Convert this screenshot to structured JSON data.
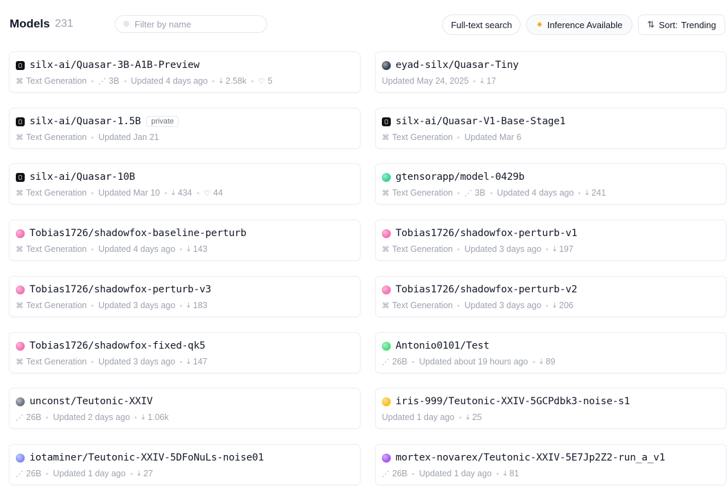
{
  "header": {
    "title": "Models",
    "count": "231",
    "filter_placeholder": "Filter by name",
    "full_text_search": "Full-text search",
    "inference_available": "Inference Available",
    "sort_label": "Sort:",
    "sort_value": "Trending"
  },
  "colors": {
    "accent": "#f59e0b",
    "border": "#e5e7eb",
    "muted_text": "#9ca3af"
  },
  "models": [
    {
      "name": "silx-ai/Quasar-3B-A1B-Preview",
      "avatar": "dark-square",
      "badge": "",
      "pipeline": "Text Generation",
      "params": "3B",
      "updated": "Updated 4 days ago",
      "downloads": "2.58k",
      "likes": "5"
    },
    {
      "name": "eyad-silx/Quasar-Tiny",
      "avatar": "#374151",
      "badge": "",
      "pipeline": "",
      "params": "",
      "updated": "Updated May 24, 2025",
      "downloads": "17",
      "likes": ""
    },
    {
      "name": "silx-ai/Quasar-1.5B",
      "avatar": "dark-square",
      "badge": "private",
      "pipeline": "Text Generation",
      "params": "",
      "updated": "Updated Jan 21",
      "downloads": "",
      "likes": ""
    },
    {
      "name": "silx-ai/Quasar-V1-Base-Stage1",
      "avatar": "dark-square",
      "badge": "",
      "pipeline": "Text Generation",
      "params": "",
      "updated": "Updated Mar 6",
      "downloads": "",
      "likes": ""
    },
    {
      "name": "silx-ai/Quasar-10B",
      "avatar": "dark-square",
      "badge": "",
      "pipeline": "Text Generation",
      "params": "",
      "updated": "Updated Mar 10",
      "downloads": "434",
      "likes": "44"
    },
    {
      "name": "gtensorapp/model-0429b",
      "avatar": "#34d399",
      "badge": "",
      "pipeline": "Text Generation",
      "params": "3B",
      "updated": "Updated 4 days ago",
      "downloads": "241",
      "likes": ""
    },
    {
      "name": "Tobias1726/shadowfox-baseline-perturb",
      "avatar": "#f472b6",
      "badge": "",
      "pipeline": "Text Generation",
      "params": "",
      "updated": "Updated 4 days ago",
      "downloads": "143",
      "likes": ""
    },
    {
      "name": "Tobias1726/shadowfox-perturb-v1",
      "avatar": "#f472b6",
      "badge": "",
      "pipeline": "Text Generation",
      "params": "",
      "updated": "Updated 3 days ago",
      "downloads": "197",
      "likes": ""
    },
    {
      "name": "Tobias1726/shadowfox-perturb-v3",
      "avatar": "#f472b6",
      "badge": "",
      "pipeline": "Text Generation",
      "params": "",
      "updated": "Updated 3 days ago",
      "downloads": "183",
      "likes": ""
    },
    {
      "name": "Tobias1726/shadowfox-perturb-v2",
      "avatar": "#f472b6",
      "badge": "",
      "pipeline": "Text Generation",
      "params": "",
      "updated": "Updated 3 days ago",
      "downloads": "206",
      "likes": ""
    },
    {
      "name": "Tobias1726/shadowfox-fixed-qk5",
      "avatar": "#f472b6",
      "badge": "",
      "pipeline": "Text Generation",
      "params": "",
      "updated": "Updated 3 days ago",
      "downloads": "147",
      "likes": ""
    },
    {
      "name": "Antonio0101/Test",
      "avatar": "#4ade80",
      "badge": "",
      "pipeline": "",
      "params": "26B",
      "updated": "Updated about 19 hours ago",
      "downloads": "89",
      "likes": ""
    },
    {
      "name": "unconst/Teutonic-XXIV",
      "avatar": "#6b7280",
      "badge": "",
      "pipeline": "",
      "params": "26B",
      "updated": "Updated 2 days ago",
      "downloads": "1.06k",
      "likes": ""
    },
    {
      "name": "iris-999/Teutonic-XXIV-5GCPdbk3-noise-s1",
      "avatar": "#fbbf24",
      "badge": "",
      "pipeline": "",
      "params": "",
      "updated": "Updated 1 day ago",
      "downloads": "25",
      "likes": ""
    },
    {
      "name": "iotaminer/Teutonic-XXIV-5DFoNuLs-noise01",
      "avatar": "#818cf8",
      "badge": "",
      "pipeline": "",
      "params": "26B",
      "updated": "Updated 1 day ago",
      "downloads": "27",
      "likes": ""
    },
    {
      "name": "mortex-novarex/Teutonic-XXIV-5E7Jp2Z2-run_a_v1",
      "avatar": "#a855f7",
      "badge": "",
      "pipeline": "",
      "params": "26B",
      "updated": "Updated 1 day ago",
      "downloads": "81",
      "likes": ""
    }
  ]
}
